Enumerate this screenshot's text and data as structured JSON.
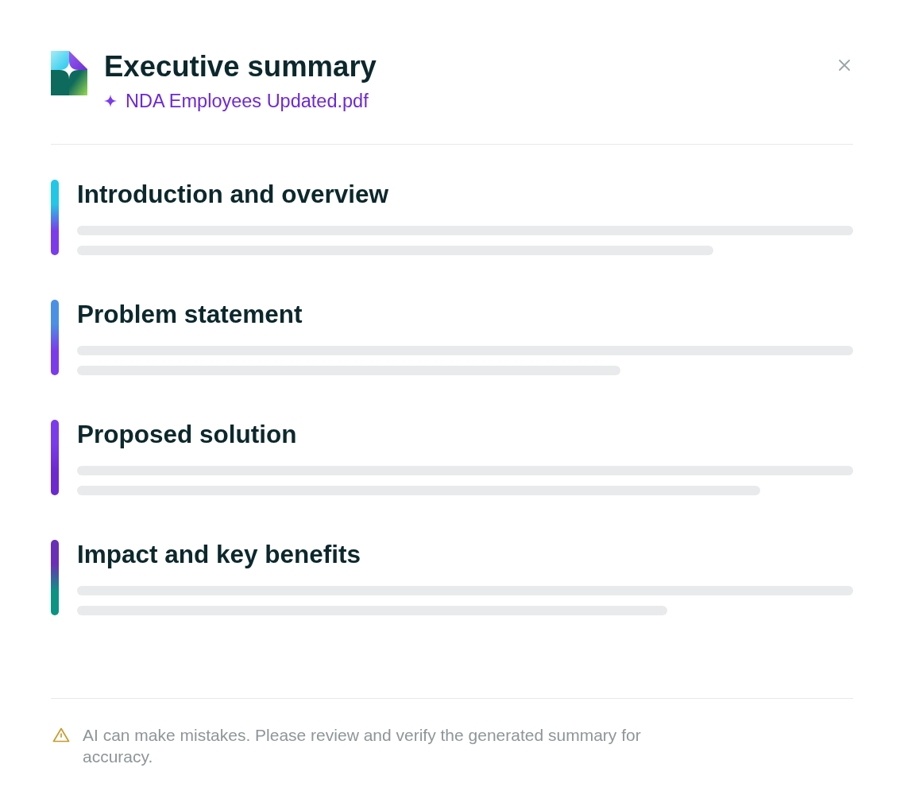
{
  "header": {
    "title": "Executive summary",
    "file_name": "NDA Employees Updated.pdf"
  },
  "sections": [
    {
      "title": "Introduction and overview",
      "gradient": [
        {
          "color": "#22c7e8"
        },
        {
          "color": "#7c3aed"
        }
      ],
      "loading": true
    },
    {
      "title": "Problem statement",
      "gradient": [
        {
          "color": "#4a90e6"
        },
        {
          "color": "#7c3aed"
        }
      ],
      "loading": true
    },
    {
      "title": "Proposed solution",
      "gradient": [
        {
          "color": "#7c3aed"
        },
        {
          "color": "#6d28d0"
        }
      ],
      "loading": true
    },
    {
      "title": "Impact and key benefits",
      "gradient": [
        {
          "color": "#6a2fb8"
        },
        {
          "color": "#0b9483"
        }
      ],
      "loading": true
    }
  ],
  "footer": {
    "warning": "AI can make mistakes. Please review and verify the generated summary for accuracy."
  }
}
